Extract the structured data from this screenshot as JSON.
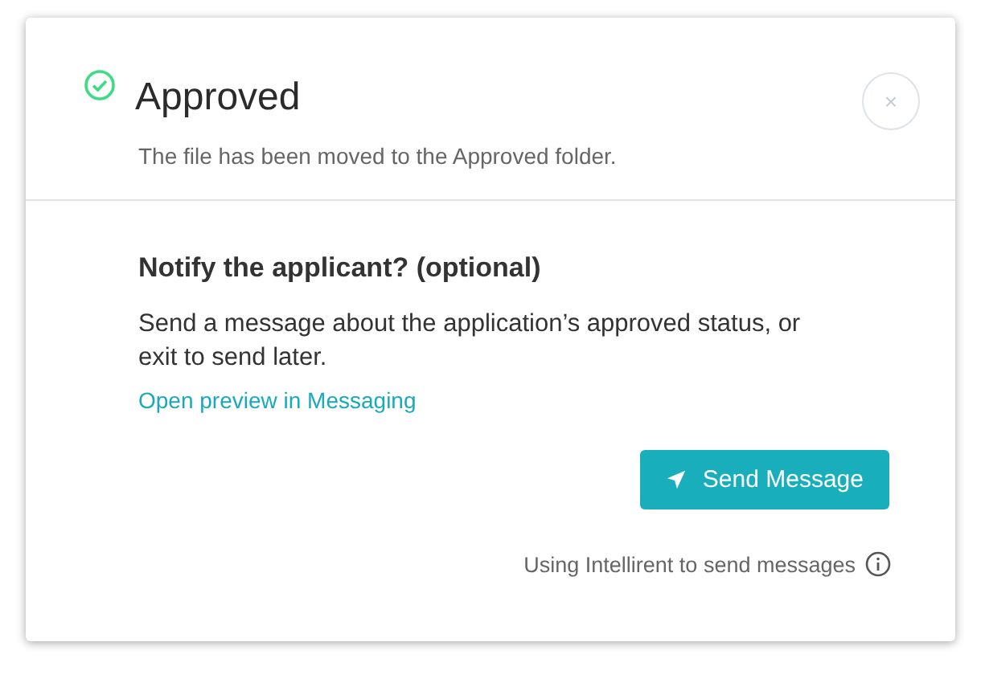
{
  "dialog": {
    "title": "Approved",
    "subtitle": "The file has been moved to the Approved folder.",
    "close": "×"
  },
  "notify": {
    "heading": "Notify the applicant? (optional)",
    "text": "Send a message about the application’s approved status, or exit to send later.",
    "link": "Open preview in Messaging",
    "button": "Send Message",
    "footer": "Using Intellirent to send messages"
  }
}
